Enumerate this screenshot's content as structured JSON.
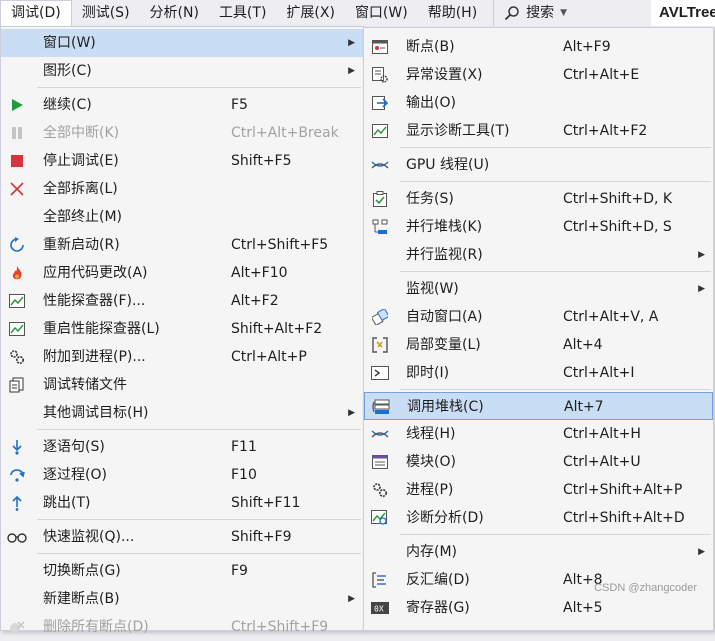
{
  "menubar": {
    "items": [
      "调试(D)",
      "测试(S)",
      "分析(N)",
      "工具(T)",
      "扩展(X)",
      "窗口(W)",
      "帮助(H)"
    ],
    "search": "搜索",
    "app_title": "AVLTree"
  },
  "left_menu": {
    "window": "窗口(W)",
    "graphics": "图形(C)",
    "continue": {
      "label": "继续(C)",
      "shortcut": "F5"
    },
    "break_all": {
      "label": "全部中断(K)",
      "shortcut": "Ctrl+Alt+Break"
    },
    "stop": {
      "label": "停止调试(E)",
      "shortcut": "Shift+F5"
    },
    "detach_all": {
      "label": "全部拆离(L)"
    },
    "terminate_all": {
      "label": "全部终止(M)"
    },
    "restart": {
      "label": "重新启动(R)",
      "shortcut": "Ctrl+Shift+F5"
    },
    "apply_changes": {
      "label": "应用代码更改(A)",
      "shortcut": "Alt+F10"
    },
    "profiler": {
      "label": "性能探查器(F)...",
      "shortcut": "Alt+F2"
    },
    "relaunch_profiler": {
      "label": "重启性能探查器(L)",
      "shortcut": "Shift+Alt+F2"
    },
    "attach": {
      "label": "附加到进程(P)...",
      "shortcut": "Ctrl+Alt+P"
    },
    "dump": {
      "label": "调试转储文件"
    },
    "other_targets": {
      "label": "其他调试目标(H)"
    },
    "step_into": {
      "label": "逐语句(S)",
      "shortcut": "F11"
    },
    "step_over": {
      "label": "逐过程(O)",
      "shortcut": "F10"
    },
    "step_out": {
      "label": "跳出(T)",
      "shortcut": "Shift+F11"
    },
    "quick_watch": {
      "label": "快速监视(Q)...",
      "shortcut": "Shift+F9"
    },
    "toggle_bp": {
      "label": "切换断点(G)",
      "shortcut": "F9"
    },
    "new_bp": {
      "label": "新建断点(B)"
    },
    "delete_bps": {
      "label": "删除所有断点(D)",
      "shortcut": "Ctrl+Shift+F9"
    }
  },
  "right_menu": {
    "breakpoints": {
      "label": "断点(B)",
      "shortcut": "Alt+F9"
    },
    "exceptions": {
      "label": "异常设置(X)",
      "shortcut": "Ctrl+Alt+E"
    },
    "output": {
      "label": "输出(O)"
    },
    "diag_tools": {
      "label": "显示诊断工具(T)",
      "shortcut": "Ctrl+Alt+F2"
    },
    "gpu_threads": {
      "label": "GPU 线程(U)"
    },
    "tasks": {
      "label": "任务(S)",
      "shortcut": "Ctrl+Shift+D, K"
    },
    "parallel_stacks": {
      "label": "并行堆栈(K)",
      "shortcut": "Ctrl+Shift+D, S"
    },
    "parallel_watch": {
      "label": "并行监视(R)"
    },
    "watch": {
      "label": "监视(W)"
    },
    "autos": {
      "label": "自动窗口(A)",
      "shortcut": "Ctrl+Alt+V, A"
    },
    "locals": {
      "label": "局部变量(L)",
      "shortcut": "Alt+4"
    },
    "immediate": {
      "label": "即时(I)",
      "shortcut": "Ctrl+Alt+I"
    },
    "call_stack": {
      "label": "调用堆栈(C)",
      "shortcut": "Alt+7"
    },
    "threads": {
      "label": "线程(H)",
      "shortcut": "Ctrl+Alt+H"
    },
    "modules": {
      "label": "模块(O)",
      "shortcut": "Ctrl+Alt+U"
    },
    "processes": {
      "label": "进程(P)",
      "shortcut": "Ctrl+Shift+Alt+P"
    },
    "diag_analysis": {
      "label": "诊断分析(D)",
      "shortcut": "Ctrl+Shift+Alt+D"
    },
    "memory": {
      "label": "内存(M)"
    },
    "disassembly": {
      "label": "反汇编(D)",
      "shortcut": "Alt+8"
    },
    "registers": {
      "label": "寄存器(G)",
      "shortcut": "Alt+5"
    }
  },
  "watermark": "CSDN @zhangcoder",
  "colors": {
    "highlight": "#c9def5",
    "highlight_border": "#6fa2d9",
    "menu_bg": "#f5f5f5",
    "disabled": "#a2a2a2"
  }
}
